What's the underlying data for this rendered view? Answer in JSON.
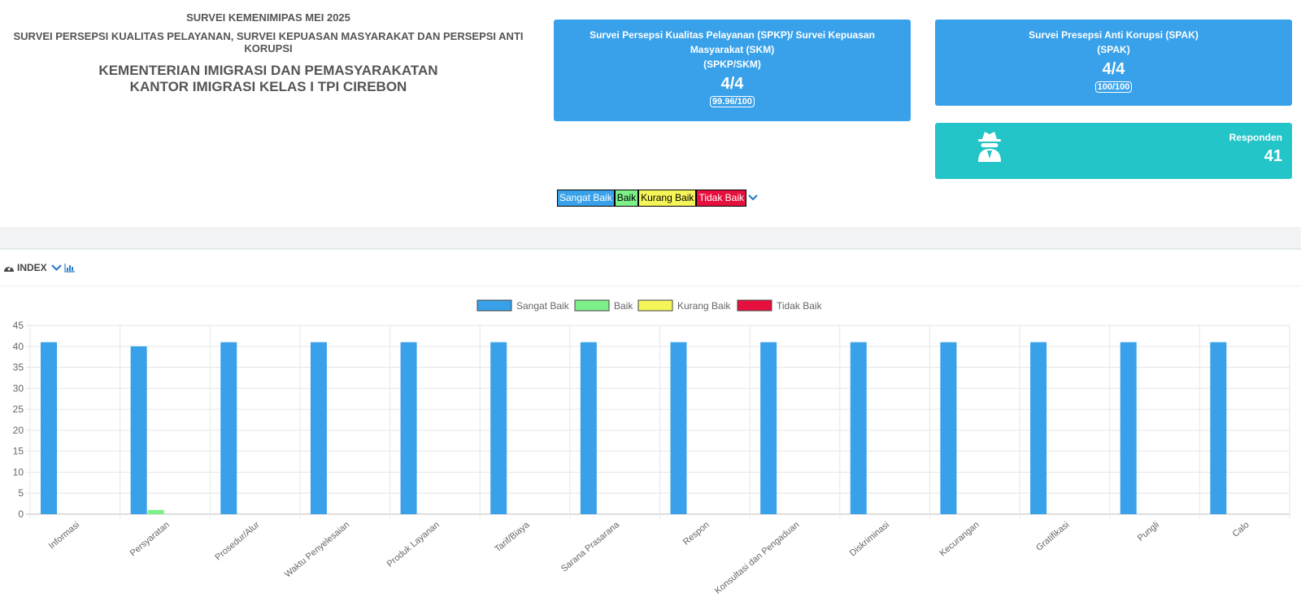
{
  "header": {
    "line1": "SURVEI KEMENIMIPAS MEI 2025",
    "line2": "SURVEI PERSEPSI KUALITAS PELAYANAN, SURVEI KEPUASAN MASYARAKAT DAN PERSEPSI ANTI KORUPSI",
    "line3": "KEMENTERIAN IMIGRASI DAN PEMASYARAKATAN",
    "line4": "KANTOR IMIGRASI KELAS I TPI CIREBON"
  },
  "cards": {
    "spkp": {
      "title1": "Survei Persepsi Kualitas Pelayanan (SPKP)/ Survei Kepuasan",
      "title2": "Masyarakat (SKM)",
      "title3": "(SPKP/SKM)",
      "score": "4/4",
      "detail": "99.96/100"
    },
    "spak": {
      "title1": "Survei Presepsi Anti Korupsi (SPAK)",
      "title2": "(SPAK)",
      "score": "4/4",
      "detail": "100/100"
    },
    "respondents": {
      "label": "Responden",
      "value": "41",
      "icon": "spy-icon"
    }
  },
  "rating_legend": {
    "items": [
      "Sangat Baik",
      "Baik",
      "Kurang Baik",
      "Tidak Baik"
    ]
  },
  "panel": {
    "title": "INDEX",
    "icons": [
      "dashboard-icon",
      "chevron-down-icon",
      "bar-chart-icon"
    ]
  },
  "colors": {
    "sangat_baik": "#38a1ea",
    "baik": "#7ef08a",
    "kurang_baik": "#f5f55a",
    "tidak_baik": "#e5103d",
    "card_blue": "#38a1ea",
    "card_teal": "#24c5c8"
  },
  "chart_data": {
    "type": "bar",
    "categories": [
      "Informasi",
      "Persyaratan",
      "Prosedur/Alur",
      "Waktu Penyelesaian",
      "Produk Layanan",
      "Tarif/Biaya",
      "Sarana Prasarana",
      "Respon",
      "Konsultasi dan Pengaduan",
      "Diskriminasi",
      "Kecurangan",
      "Gratifikasi",
      "Pungli",
      "Calo"
    ],
    "series": [
      {
        "name": "Sangat Baik",
        "color": "#38a1ea",
        "values": [
          41,
          40,
          41,
          41,
          41,
          41,
          41,
          41,
          41,
          41,
          41,
          41,
          41,
          41
        ]
      },
      {
        "name": "Baik",
        "color": "#7ef08a",
        "values": [
          0,
          1,
          0,
          0,
          0,
          0,
          0,
          0,
          0,
          0,
          0,
          0,
          0,
          0
        ]
      },
      {
        "name": "Kurang Baik",
        "color": "#f5f55a",
        "values": [
          0,
          0,
          0,
          0,
          0,
          0,
          0,
          0,
          0,
          0,
          0,
          0,
          0,
          0
        ]
      },
      {
        "name": "Tidak Baik",
        "color": "#e5103d",
        "values": [
          0,
          0,
          0,
          0,
          0,
          0,
          0,
          0,
          0,
          0,
          0,
          0,
          0,
          0
        ]
      }
    ],
    "ylim": [
      0,
      45
    ],
    "yticks": [
      0,
      5,
      10,
      15,
      20,
      25,
      30,
      35,
      40,
      45
    ],
    "grid": true,
    "legend_position": "top-center"
  }
}
